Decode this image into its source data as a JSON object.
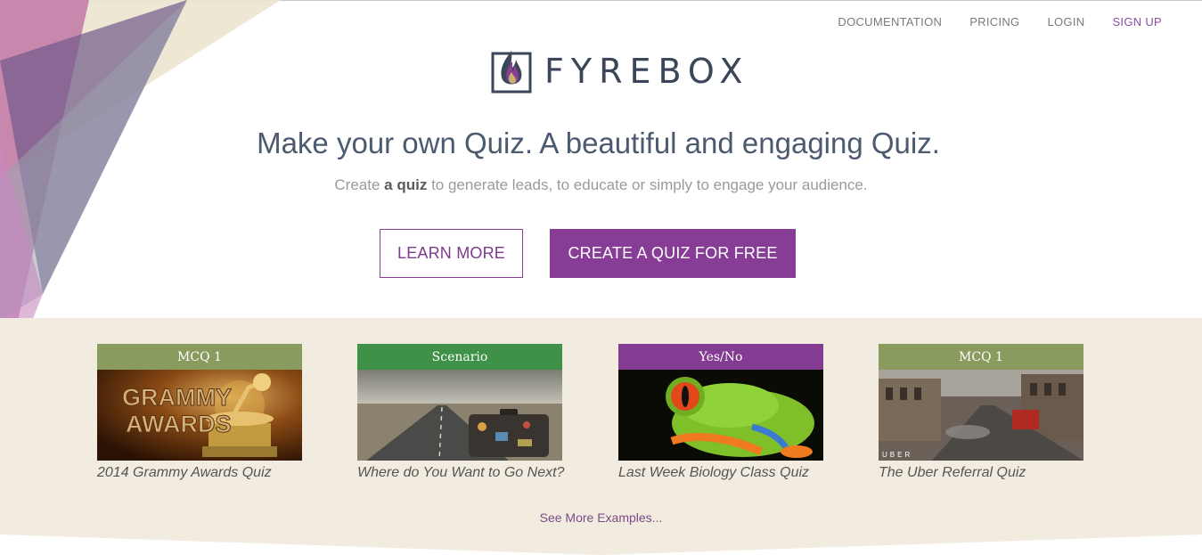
{
  "nav": {
    "items": [
      "DOCUMENTATION",
      "PRICING",
      "LOGIN",
      "SIGN UP"
    ]
  },
  "logo": {
    "icon": "flame-icon",
    "wordmark": "FYREBOX"
  },
  "hero": {
    "headline": "Make your own Quiz. A beautiful and engaging Quiz.",
    "sub_before": "Create",
    "sub_bold": "a quiz",
    "sub_after": "to generate leads, to educate or simply to engage your audience.",
    "learn_more_label": "LEARN MORE",
    "create_label": "CREATE A QUIZ FOR FREE"
  },
  "examples": {
    "cards": [
      {
        "tag": "MCQ 1",
        "tag_color": "#8a9b5f",
        "title": "2014 Grammy Awards Quiz",
        "image": "grammy-awards-image",
        "image_text": [
          "GRAMMY",
          "AWARDS"
        ]
      },
      {
        "tag": "Scenario",
        "tag_color": "#3f9147",
        "title": "Where do You Want to Go Next?",
        "image": "road-suitcase-image"
      },
      {
        "tag": "Yes/No",
        "tag_color": "#843c93",
        "title": "Last Week Biology Class Quiz",
        "image": "tree-frog-image"
      },
      {
        "tag": "MCQ 1",
        "tag_color": "#8a9b5f",
        "title": "The Uber Referral Quiz",
        "image": "city-street-image",
        "image_text": [
          "UBER"
        ]
      }
    ],
    "see_more_label": "See More Examples..."
  },
  "colors": {
    "brand_purple": "#873c96",
    "examples_bg": "#f2ece0",
    "headline": "#4b5a6e"
  }
}
